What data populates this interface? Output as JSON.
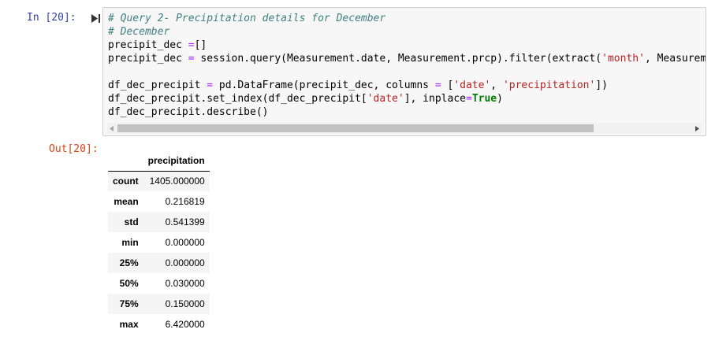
{
  "cell_in": {
    "prompt": "In [20]:",
    "code": {
      "line1": "# Query 2- Precipitation details for December",
      "line2": "# December",
      "line3_a": "precipit_dec ",
      "line3_op": "=",
      "line3_b": "[]",
      "line4_a": "precipit_dec ",
      "line4_op": "=",
      "line4_b": " session.query(Measurement.date, Measurement.prcp).filter(extract(",
      "line4_str": "'month'",
      "line4_c": ", Measuremen",
      "line6_a": "df_dec_precipit ",
      "line6_op": "=",
      "line6_b": " pd.DataFrame(precipit_dec, columns ",
      "line6_op2": "=",
      "line6_c": " [",
      "line6_str1": "'date'",
      "line6_d": ", ",
      "line6_str2": "'precipitation'",
      "line6_e": "])",
      "line7_a": "df_dec_precipit.set_index(df_dec_precipit[",
      "line7_str": "'date'",
      "line7_b": "], inplace",
      "line7_op": "=",
      "line7_kw": "True",
      "line7_c": ")",
      "line8": "df_dec_precipit.describe()"
    }
  },
  "cell_out": {
    "prompt": "Out[20]:",
    "table": {
      "column": "precipitation",
      "rows": [
        {
          "label": "count",
          "value": "1405.000000"
        },
        {
          "label": "mean",
          "value": "0.216819"
        },
        {
          "label": "std",
          "value": "0.541399"
        },
        {
          "label": "min",
          "value": "0.000000"
        },
        {
          "label": "25%",
          "value": "0.000000"
        },
        {
          "label": "50%",
          "value": "0.030000"
        },
        {
          "label": "75%",
          "value": "0.150000"
        },
        {
          "label": "max",
          "value": "6.420000"
        }
      ]
    }
  },
  "colors": {
    "prompt_in": "#303F9F",
    "prompt_out": "#D84315",
    "comment": "#408080",
    "string": "#BA2121",
    "keyword": "#008000",
    "operator": "#AA22FF"
  },
  "icons": {
    "run": "run-cell-icon",
    "scroll_left": "scroll-left-arrow-icon",
    "scroll_right": "scroll-right-arrow-icon"
  }
}
